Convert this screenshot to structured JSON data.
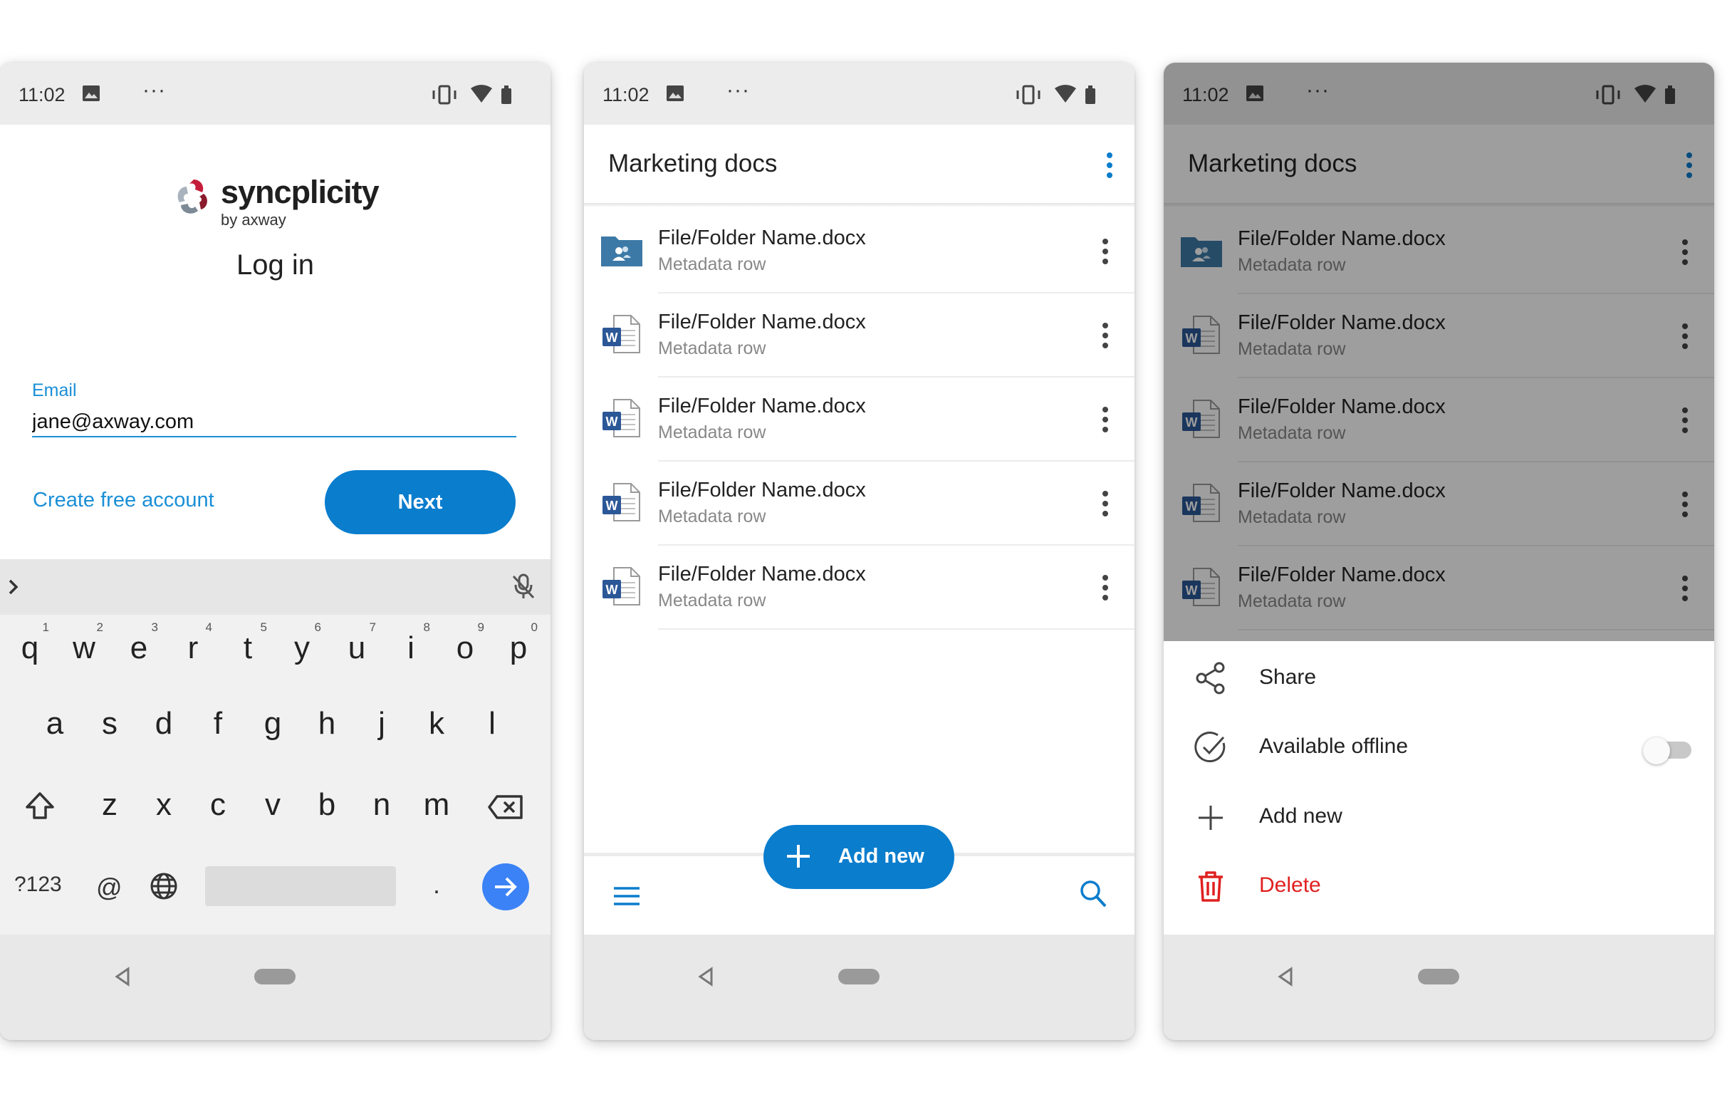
{
  "colors": {
    "accent": "#0a7dcd",
    "link": "#1a8fd6",
    "danger": "#e02020",
    "folder": "#3d79a6",
    "word": "#2b5797"
  },
  "status_bar": {
    "time": "11:02",
    "dots": "···"
  },
  "login": {
    "brand": "syncplicity",
    "brand_sub": "by axway",
    "title": "Log in",
    "email_label": "Email",
    "email_value": "jane@axway.com",
    "create_account": "Create free account",
    "next": "Next"
  },
  "keyboard": {
    "row1": [
      {
        "k": "q",
        "n": "1"
      },
      {
        "k": "w",
        "n": "2"
      },
      {
        "k": "e",
        "n": "3"
      },
      {
        "k": "r",
        "n": "4"
      },
      {
        "k": "t",
        "n": "5"
      },
      {
        "k": "y",
        "n": "6"
      },
      {
        "k": "u",
        "n": "7"
      },
      {
        "k": "i",
        "n": "8"
      },
      {
        "k": "o",
        "n": "9"
      },
      {
        "k": "p",
        "n": "0"
      }
    ],
    "row2": [
      "a",
      "s",
      "d",
      "f",
      "g",
      "h",
      "j",
      "k",
      "l"
    ],
    "row3": [
      "z",
      "x",
      "c",
      "v",
      "b",
      "n",
      "m"
    ],
    "symbols_key": "?123",
    "at_key": "@",
    "period_key": "."
  },
  "files": {
    "title": "Marketing docs",
    "rows": [
      {
        "name": "File/Folder Name.docx",
        "meta": "Metadata row",
        "icon": "shared-folder-icon"
      },
      {
        "name": "File/Folder Name.docx",
        "meta": "Metadata row",
        "icon": "word-doc-icon"
      },
      {
        "name": "File/Folder Name.docx",
        "meta": "Metadata row",
        "icon": "word-doc-icon"
      },
      {
        "name": "File/Folder Name.docx",
        "meta": "Metadata row",
        "icon": "word-doc-icon"
      },
      {
        "name": "File/Folder Name.docx",
        "meta": "Metadata row",
        "icon": "word-doc-icon"
      }
    ],
    "add_new": "Add new"
  },
  "sheet": {
    "share": "Share",
    "offline": "Available offline",
    "offline_enabled": false,
    "add_new": "Add new",
    "delete": "Delete"
  }
}
